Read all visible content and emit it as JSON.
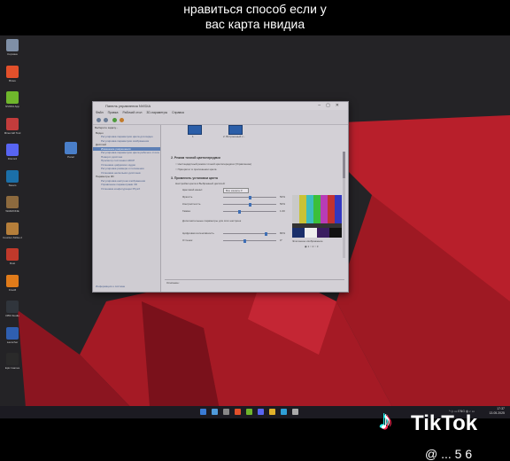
{
  "caption": {
    "line1": "нравиться способ если у",
    "line2": "вас карта нвидиа"
  },
  "colors": {
    "wallpaper_bg": "#242326",
    "wallpaper_red": "#b81f2b",
    "window_bg": "#c9c6cc",
    "accent": "#3f6fb5",
    "taskbar": "#1c1b22"
  },
  "desktop_icons": [
    {
      "name": "recycle-bin-icon",
      "label": "Корзина",
      "color": "#7f8fa6"
    },
    {
      "name": "brave-icon",
      "label": "Brave",
      "color": "#e2502b"
    },
    {
      "name": "nvidia-app-icon",
      "label": "NVIDIA App",
      "color": "#6fb62c"
    },
    {
      "name": "game-icon",
      "label": "Minecraft Tool",
      "color": "#c23c3c"
    },
    {
      "name": "discord-icon",
      "label": "Discord",
      "color": "#5865f2"
    },
    {
      "name": "steam-icon",
      "label": "Steam",
      "color": "#1b6fa8"
    },
    {
      "name": "game-icon-2",
      "label": "WARZONE",
      "color": "#8d6a3e"
    },
    {
      "name": "game-icon-3",
      "label": "Counter-Strike 2",
      "color": "#b57e3a"
    },
    {
      "name": "game-icon-4",
      "label": "Rust",
      "color": "#c0392b"
    },
    {
      "name": "game-icon-5",
      "label": "FiveM",
      "color": "#e07b1a"
    },
    {
      "name": "obs-icon",
      "label": "OBS Studio",
      "color": "#30353c"
    },
    {
      "name": "app-icon",
      "label": "Launcher",
      "color": "#2f5fb0"
    },
    {
      "name": "epic-games-icon",
      "label": "Epic Games",
      "color": "#2a2a2a"
    }
  ],
  "extra_icon": {
    "label": "Panel",
    "color": "#4a7fc9"
  },
  "window": {
    "title": "Панель управления NVIDIA",
    "menu": [
      "Файл",
      "Правка",
      "Рабочий стол",
      "3D-параметры",
      "Справка"
    ],
    "tree_header": "Выберите задачу...",
    "tree": [
      {
        "label": "Видео",
        "sel": false
      },
      {
        "label": "Регулировка параметров цвета для видео",
        "sel": false
      },
      {
        "label": "Регулировка параметров изображения",
        "sel": false
      },
      {
        "label": "Дисплей",
        "sel": false
      },
      {
        "label": "Изменение разрешения",
        "sel": true
      },
      {
        "label": "Регулировка параметров цвета рабочего стола",
        "sel": false
      },
      {
        "label": "Поворот дисплея",
        "sel": false
      },
      {
        "label": "Просмотр состояния HDCP",
        "sel": false
      },
      {
        "label": "Установка цифрового аудио",
        "sel": false
      },
      {
        "label": "Регулировка размера и положения",
        "sel": false
      },
      {
        "label": "Установка нескольких дисплеев",
        "sel": false
      },
      {
        "label": "Параметры 3D",
        "sel": false
      },
      {
        "label": "Регулировка настроек изображения",
        "sel": false
      },
      {
        "label": "Управление параметрами 3D",
        "sel": false
      },
      {
        "label": "Установка конфигурации PhysX",
        "sel": false
      }
    ],
    "bottom_link": "Информация о системе",
    "monitors": [
      {
        "label": "1"
      },
      {
        "label": "2. Встроенный с..."
      }
    ],
    "section2_title": "2. Режим точной цветопередачи",
    "radio1": "Нестандартный режим точной цветопередачи (Управление)",
    "radio2": "Приоритет в приложении цвета",
    "section3_title": "3. Применить установки цвета",
    "subhead": "Настройки цвета в Выбранный дисплей:",
    "channel_label": "Цветовой канал:",
    "channel_value": "Все каналы",
    "sliders": [
      {
        "name": "Яркость",
        "value": "50%",
        "pos": 0.5
      },
      {
        "name": "Контрастность",
        "value": "50%",
        "pos": 0.5
      },
      {
        "name": "Гамма",
        "value": "1.00",
        "pos": 0.3
      }
    ],
    "note": "Дополнительные параметры для этих настроек",
    "sliders2": [
      {
        "name": "Цифровая интенсивность",
        "value": "80%",
        "pos": 0.8
      },
      {
        "name": "Оттенок",
        "value": "0°",
        "pos": 0.4
      }
    ],
    "reference_label": "Эталонное изображение",
    "reference_options": [
      "1",
      "2",
      "3"
    ],
    "description": "Описание:"
  },
  "taskbar": {
    "tray_text": "ENG",
    "time": "17:37",
    "date": "13.05.2025",
    "icons": [
      "#3a7bd5",
      "#4f9bdb",
      "#888",
      "#e2502b",
      "#6fb62c",
      "#5865f2",
      "#e0b12a",
      "#2f9fd6",
      "#aaa"
    ]
  },
  "branding": {
    "tiktok": "TikTok",
    "handle": "@ ... 5 6"
  }
}
